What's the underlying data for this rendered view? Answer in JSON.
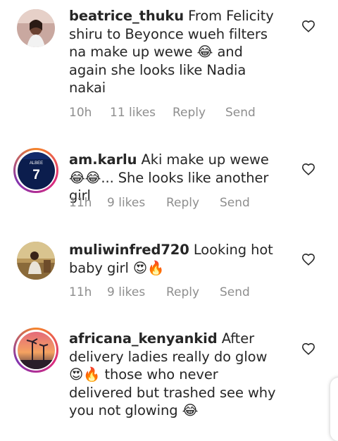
{
  "comments": [
    {
      "username": "beatrice_thuku",
      "text": "From Felicity shiru to Beyonce wueh filters na make up wewe 😂 and again she looks like Nadia nakai",
      "time": "10h",
      "likes": "11 likes",
      "reply": "Reply",
      "send": "Send"
    },
    {
      "username": "am.karlu",
      "text": "Aki make up wewe😂😂... She looks like another girl",
      "time": "11h",
      "likes": "9 likes",
      "reply": "Reply",
      "send": "Send"
    },
    {
      "username": "muliwinfred720",
      "text": "Looking hot baby girl 😍🔥",
      "time": "11h",
      "likes": "9 likes",
      "reply": "Reply",
      "send": "Send"
    },
    {
      "username": "africana_kenyankid",
      "text": "After delivery ladies really do glow😍🔥 those who never delivered but trashed see why you not glowing 😂"
    }
  ],
  "avatar_jersey_text": "ALBEE",
  "avatar_jersey_number": "7",
  "colors": {
    "meta_gray": "#8e8e8e",
    "text": "#262626",
    "story_ring": "#dd2a7b"
  }
}
